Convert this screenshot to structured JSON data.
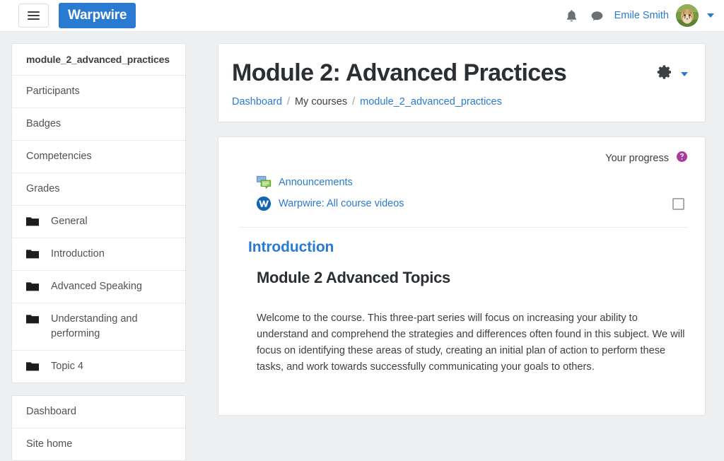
{
  "navbar": {
    "menu_toggle_label": "hamburger-menu",
    "brand": "Warpwire",
    "notifications_icon": "bell-icon",
    "messages_icon": "message-bubble-icon",
    "user_name": "Emile Smith",
    "avatar_alt": "cheetah-avatar",
    "user_menu_caret": "chevron-down-icon"
  },
  "sidebar": {
    "blocks": [
      {
        "items": [
          {
            "label": "module_2_advanced_practices",
            "current": true,
            "icon": null
          },
          {
            "label": "Participants",
            "current": false,
            "icon": null
          },
          {
            "label": "Badges",
            "current": false,
            "icon": null
          },
          {
            "label": "Competencies",
            "current": false,
            "icon": null
          },
          {
            "label": "Grades",
            "current": false,
            "icon": null
          },
          {
            "label": "General",
            "current": false,
            "icon": "folder-icon"
          },
          {
            "label": "Introduction",
            "current": false,
            "icon": "folder-icon"
          },
          {
            "label": "Advanced Speaking",
            "current": false,
            "icon": "folder-icon"
          },
          {
            "label": "Understanding and performing",
            "current": false,
            "icon": "folder-icon"
          },
          {
            "label": "Topic 4",
            "current": false,
            "icon": "folder-icon"
          }
        ]
      },
      {
        "items": [
          {
            "label": "Dashboard",
            "current": false,
            "icon": null
          },
          {
            "label": "Site home",
            "current": false,
            "icon": null
          }
        ]
      }
    ]
  },
  "header": {
    "title": "Module 2: Advanced Practices",
    "gear_icon": "gear-icon",
    "gear_caret_icon": "chevron-down-icon",
    "breadcrumb": [
      {
        "label": "Dashboard",
        "link": true
      },
      {
        "label": "My courses",
        "link": false
      },
      {
        "label": "module_2_advanced_practices",
        "link": true
      }
    ],
    "breadcrumb_separator": "/"
  },
  "content": {
    "progress_label": "Your progress",
    "progress_help_icon": "help-question-icon",
    "activities": [
      {
        "label": "Announcements",
        "icon": "announcement-forum-icon",
        "has_completion_box": false
      },
      {
        "label": "Warpwire: All course videos",
        "icon": "warpwire-w-icon",
        "has_completion_box": true
      }
    ],
    "section_title": "Introduction",
    "summary_heading": "Module 2 Advanced Topics",
    "summary_text": "Welcome to the course. This three-part series will focus on increasing your ability to understand and comprehend the strategies and differences often found in this subject. We will focus on identifying these areas of study, creating an initial plan of action to perform these tasks, and work towards successfully communicating your goals to others."
  },
  "colors": {
    "brand_blue": "#2b7ad1",
    "link_blue": "#2b7ad1",
    "help_purple": "#a83a9e",
    "page_bg": "#edeff1"
  }
}
